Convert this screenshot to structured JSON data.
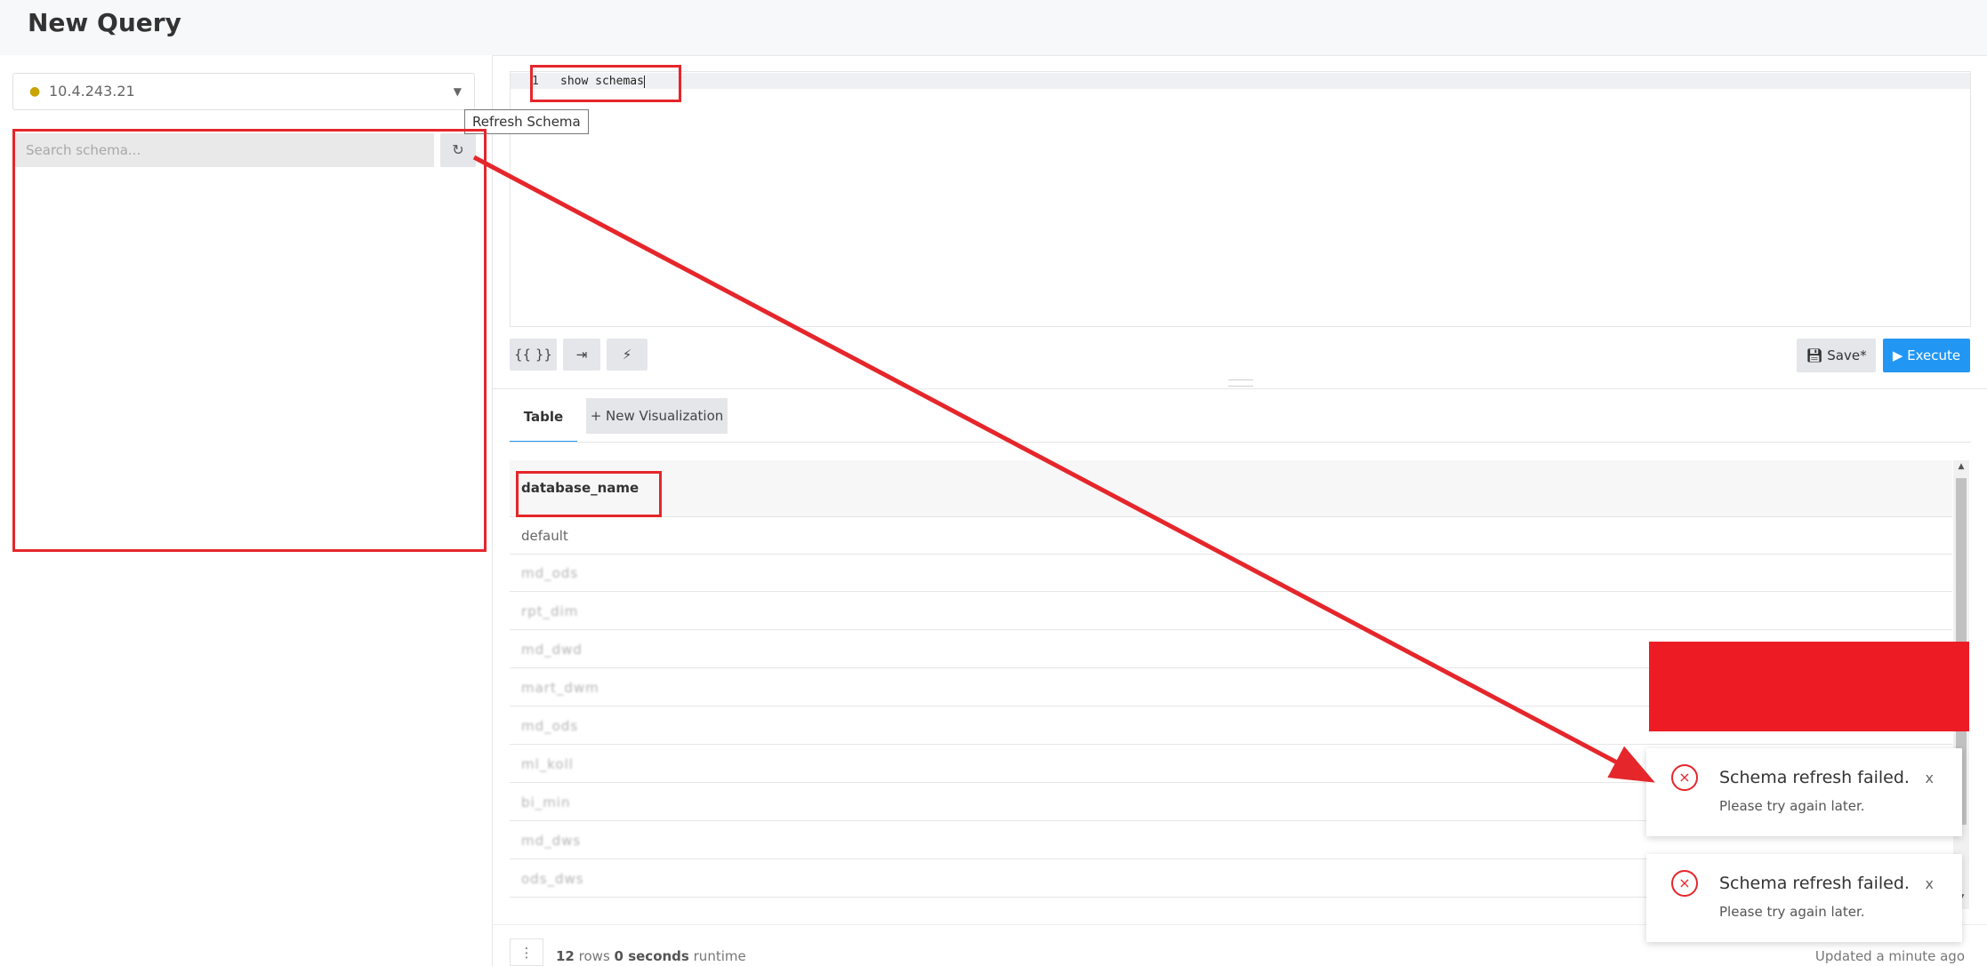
{
  "page": {
    "title": "New Query"
  },
  "left": {
    "datasource_label": "10.4.243.21",
    "datasource_icon": "hive-icon",
    "search_placeholder": "Search schema...",
    "refresh_tooltip": "Refresh Schema"
  },
  "editor": {
    "line_number": "1",
    "query": "show schemas"
  },
  "toolbar": {
    "params_label": "{{ }}",
    "format_icon": "indent-icon",
    "autocomplete_icon": "bolt-icon",
    "save_label": "Save*",
    "execute_label": "Execute"
  },
  "tabs": {
    "table_label": "Table",
    "new_vis_label": "+ New Visualization"
  },
  "results": {
    "column": "database_name",
    "rows": [
      "default",
      "md_ods",
      "rpt_dim",
      "md_dwd",
      "mart_dwm",
      "md_ods",
      "ml_koll",
      "bi_min",
      "md_dws",
      "ods_dws"
    ]
  },
  "footer": {
    "row_count": "12",
    "rows_word": "rows",
    "runtime_value": "0 seconds",
    "runtime_word": "runtime",
    "updated": "Updated a minute ago"
  },
  "toasts": [
    {
      "title": "Schema refresh failed.",
      "message": "Please try again later.",
      "close": "x"
    },
    {
      "title": "Schema refresh failed.",
      "message": "Please try again later.",
      "close": "x"
    }
  ],
  "colors": {
    "accent": "#2196f3",
    "annotation": "#e5262b"
  }
}
